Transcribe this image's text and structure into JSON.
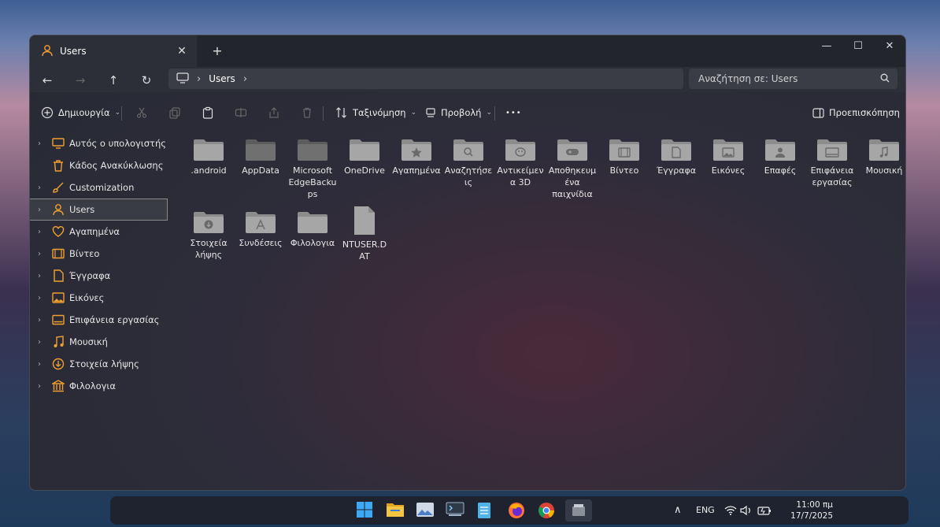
{
  "window": {
    "tab_label": "Users",
    "minimize_label": "—",
    "maximize_label": "☐",
    "close_label": "✕"
  },
  "nav": {
    "breadcrumb": [
      "Users"
    ],
    "search_placeholder": "Αναζήτηση σε: Users"
  },
  "toolbar": {
    "new_label": "Δημιουργία",
    "sort_label": "Ταξινόμηση",
    "view_label": "Προβολή",
    "more_label": "•••",
    "preview_label": "Προεπισκόπηση"
  },
  "sidebar": {
    "items": [
      {
        "label": "Αυτός ο υπολογιστής",
        "icon": "computer-icon"
      },
      {
        "label": "Κάδος Ανακύκλωσης",
        "icon": "recycle-bin-icon"
      },
      {
        "label": "Customization",
        "icon": "brush-icon"
      },
      {
        "label": "Users",
        "icon": "user-icon"
      },
      {
        "label": "Αγαπημένα",
        "icon": "heart-icon"
      },
      {
        "label": "Βίντεο",
        "icon": "video-icon"
      },
      {
        "label": "Έγγραφα",
        "icon": "document-icon"
      },
      {
        "label": "Εικόνες",
        "icon": "pictures-icon"
      },
      {
        "label": "Επιφάνεια εργασίας",
        "icon": "desktop-icon"
      },
      {
        "label": "Μουσική",
        "icon": "music-icon"
      },
      {
        "label": "Στοιχεία λήψης",
        "icon": "download-icon"
      },
      {
        "label": "Φιλολογια",
        "icon": "library-icon"
      }
    ]
  },
  "files": [
    {
      "name": ".android",
      "icon": "folder-icon"
    },
    {
      "name": "AppData",
      "icon": "folder-dark-icon"
    },
    {
      "name": "Microsoft EdgeBackups",
      "icon": "folder-dark-icon"
    },
    {
      "name": "OneDrive",
      "icon": "folder-icon"
    },
    {
      "name": "Αγαπημένα",
      "icon": "favorites-folder-icon"
    },
    {
      "name": "Αναζητήσεις",
      "icon": "search-folder-icon"
    },
    {
      "name": "Αντικείμενα 3D",
      "icon": "objects3d-folder-icon"
    },
    {
      "name": "Αποθηκευμένα παιχνίδια",
      "icon": "games-folder-icon"
    },
    {
      "name": "Βίντεο",
      "icon": "video-folder-icon"
    },
    {
      "name": "Έγγραφα",
      "icon": "documents-folder-icon"
    },
    {
      "name": "Εικόνες",
      "icon": "pictures-folder-icon"
    },
    {
      "name": "Επαφές",
      "icon": "contacts-folder-icon"
    },
    {
      "name": "Επιφάνεια εργασίας",
      "icon": "desktop-folder-icon"
    },
    {
      "name": "Μουσική",
      "icon": "music-folder-icon"
    },
    {
      "name": "Στοιχεία λήψης",
      "icon": "downloads-folder-icon"
    },
    {
      "name": "Συνδέσεις",
      "icon": "links-folder-icon"
    },
    {
      "name": "Φιλολογια",
      "icon": "folder-icon"
    },
    {
      "name": "NTUSER.DAT",
      "icon": "file-icon"
    }
  ],
  "taskbar": {
    "lang": "ENG",
    "time": "11:00 πμ",
    "date": "17/7/2025"
  },
  "colors": {
    "accent": "#f0a030",
    "folder": "#8c8c8c"
  }
}
